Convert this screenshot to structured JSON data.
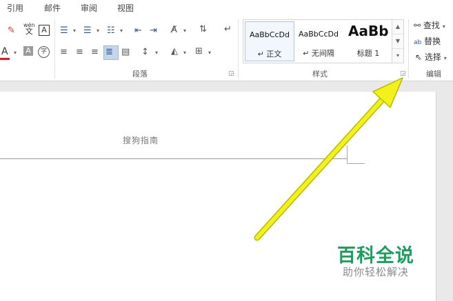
{
  "menu_tabs": [
    "引用",
    "邮件",
    "审阅",
    "视图"
  ],
  "groups": {
    "paragraph_label": "段落",
    "styles_label": "样式",
    "editing_label": "编辑"
  },
  "font_group": {
    "phonetic_guide_label": "wén",
    "phonetic_guide_char": "文",
    "enclose_char": "字"
  },
  "styles": [
    {
      "sample": "AaBbCcDd",
      "name": "↵ 正文",
      "selected": true
    },
    {
      "sample": "AaBbCcDd",
      "name": "↵ 无间隔",
      "selected": false
    },
    {
      "sample": "AaBb",
      "name": "标题 1",
      "selected": false
    }
  ],
  "editing": {
    "find": "查找",
    "replace": "替换",
    "select": "选择"
  },
  "document": {
    "header_text": "搜狗指南"
  },
  "watermark": {
    "title": "百科全说",
    "subtitle": "助你轻松解决"
  },
  "colors": {
    "arrow": "#f2f21a",
    "watermark_green": "#19a05a",
    "font_color_red": "#e11919",
    "selected_btn": "#c5d5ea"
  }
}
